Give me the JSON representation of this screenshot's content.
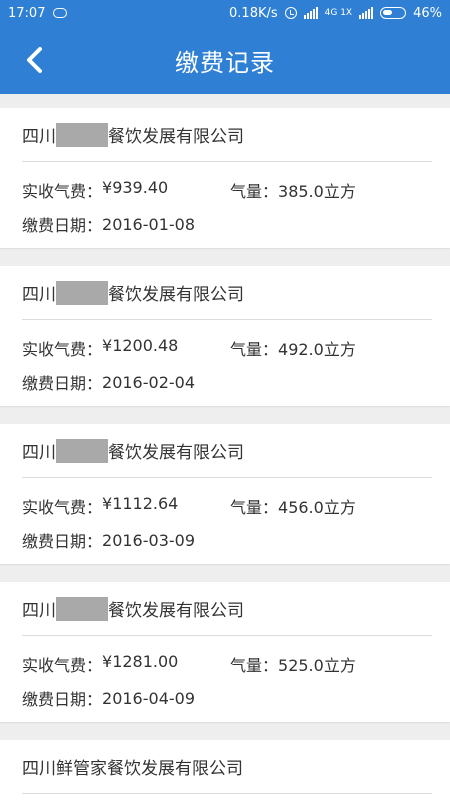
{
  "status_bar": {
    "time": "17:07",
    "network_speed": "0.18K/s",
    "network_badge": "4G 1X",
    "battery": "46%",
    "icons": [
      "cloud-icon",
      "alarm-icon",
      "signal-icon",
      "battery-icon"
    ]
  },
  "app_bar": {
    "title": "缴费记录",
    "back_icon": "chevron-left-icon",
    "color": "#2f80d4"
  },
  "labels": {
    "fee": "实收气费：",
    "volume": "气量：",
    "date": "缴费日期："
  },
  "records": [
    {
      "company_prefix": "四川",
      "company_suffix": "餐饮发展有限公司",
      "company_masked": true,
      "fee": "¥939.40",
      "volume": "385.0立方",
      "date": "2016-01-08"
    },
    {
      "company_prefix": "四川",
      "company_suffix": "餐饮发展有限公司",
      "company_masked": true,
      "fee": "¥1200.48",
      "volume": "492.0立方",
      "date": "2016-02-04"
    },
    {
      "company_prefix": "四川",
      "company_suffix": "餐饮发展有限公司",
      "company_masked": true,
      "fee": "¥1112.64",
      "volume": "456.0立方",
      "date": "2016-03-09"
    },
    {
      "company_prefix": "四川",
      "company_suffix": "餐饮发展有限公司",
      "company_masked": true,
      "fee": "¥1281.00",
      "volume": "525.0立方",
      "date": "2016-04-09"
    },
    {
      "company_full": "四川鲜管家餐饮发展有限公司",
      "company_masked": false
    }
  ]
}
